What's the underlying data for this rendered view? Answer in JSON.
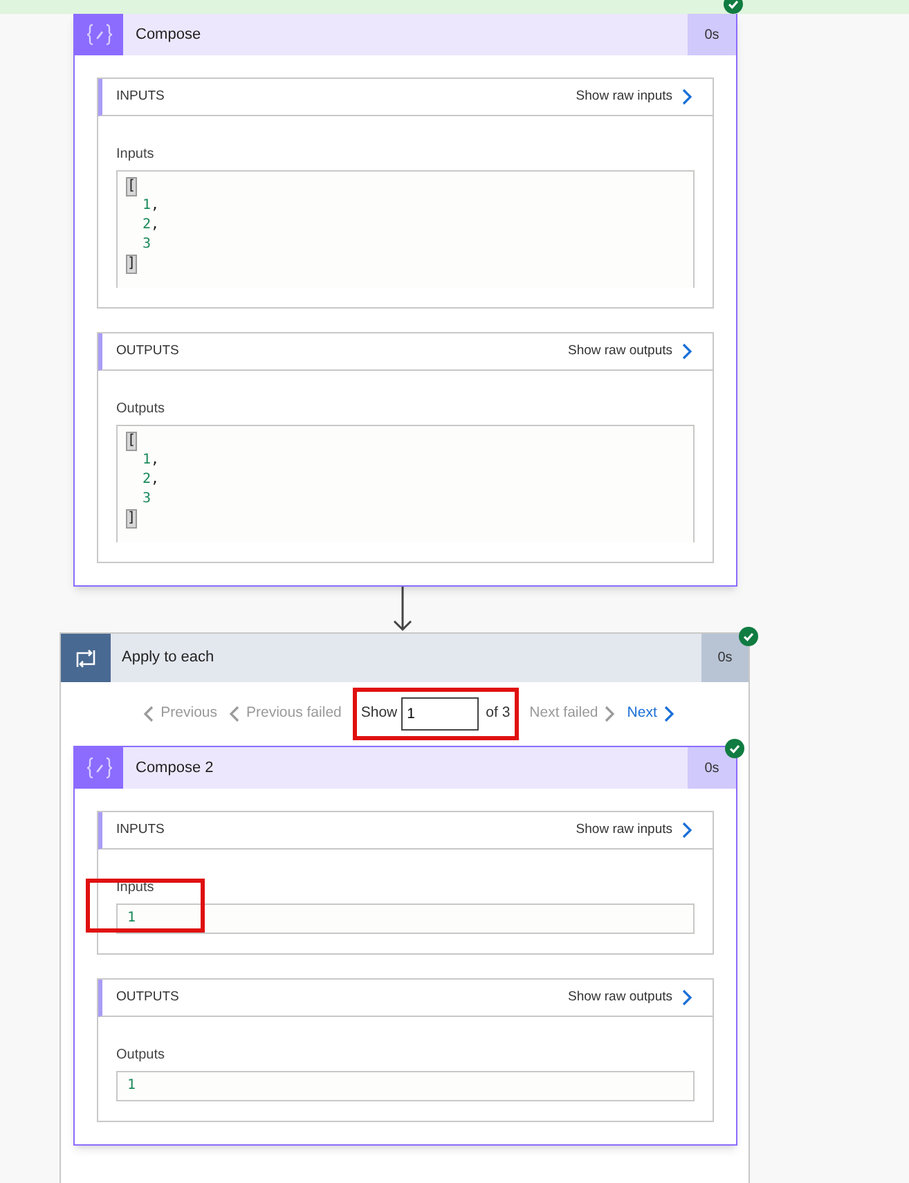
{
  "compose": {
    "title": "Compose",
    "duration": "0s",
    "succeeded": true,
    "sections": [
      {
        "heading": "INPUTS",
        "raw_link": "Show raw inputs",
        "label": "Inputs",
        "highlighted": false,
        "lines": [
          {
            "kind": "bracket",
            "text": "["
          },
          {
            "kind": "number",
            "text": "1",
            "suffix": ","
          },
          {
            "kind": "number",
            "text": "2",
            "suffix": ","
          },
          {
            "kind": "number",
            "text": "3"
          },
          {
            "kind": "bracket",
            "text": "]"
          }
        ]
      },
      {
        "heading": "OUTPUTS",
        "raw_link": "Show raw outputs",
        "label": "Outputs",
        "highlighted": false,
        "lines": [
          {
            "kind": "bracket",
            "text": "["
          },
          {
            "kind": "number",
            "text": "1",
            "suffix": ","
          },
          {
            "kind": "number",
            "text": "2",
            "suffix": ","
          },
          {
            "kind": "number",
            "text": "3"
          },
          {
            "kind": "bracket",
            "text": "]"
          }
        ]
      }
    ]
  },
  "apply_to_each": {
    "title": "Apply to each",
    "duration": "0s",
    "succeeded": true,
    "pagination": {
      "highlighted": true,
      "previous": [
        {
          "label": "Previous",
          "disabled": true
        },
        {
          "label": "Previous failed",
          "disabled": true
        }
      ],
      "show_label": "Show",
      "value": "1",
      "of_label": "of 3",
      "next": [
        {
          "label": "Next failed",
          "disabled": true
        },
        {
          "label": "Next",
          "disabled": false
        }
      ]
    },
    "inner": {
      "title": "Compose 2",
      "duration": "0s",
      "succeeded": true,
      "sections": [
        {
          "heading": "INPUTS",
          "raw_link": "Show raw inputs",
          "label": "Inputs",
          "highlighted": true,
          "lines": [
            {
              "kind": "number",
              "text": "1"
            }
          ]
        },
        {
          "heading": "OUTPUTS",
          "raw_link": "Show raw outputs",
          "label": "Outputs",
          "highlighted": false,
          "lines": [
            {
              "kind": "number",
              "text": "1"
            }
          ]
        }
      ]
    }
  }
}
